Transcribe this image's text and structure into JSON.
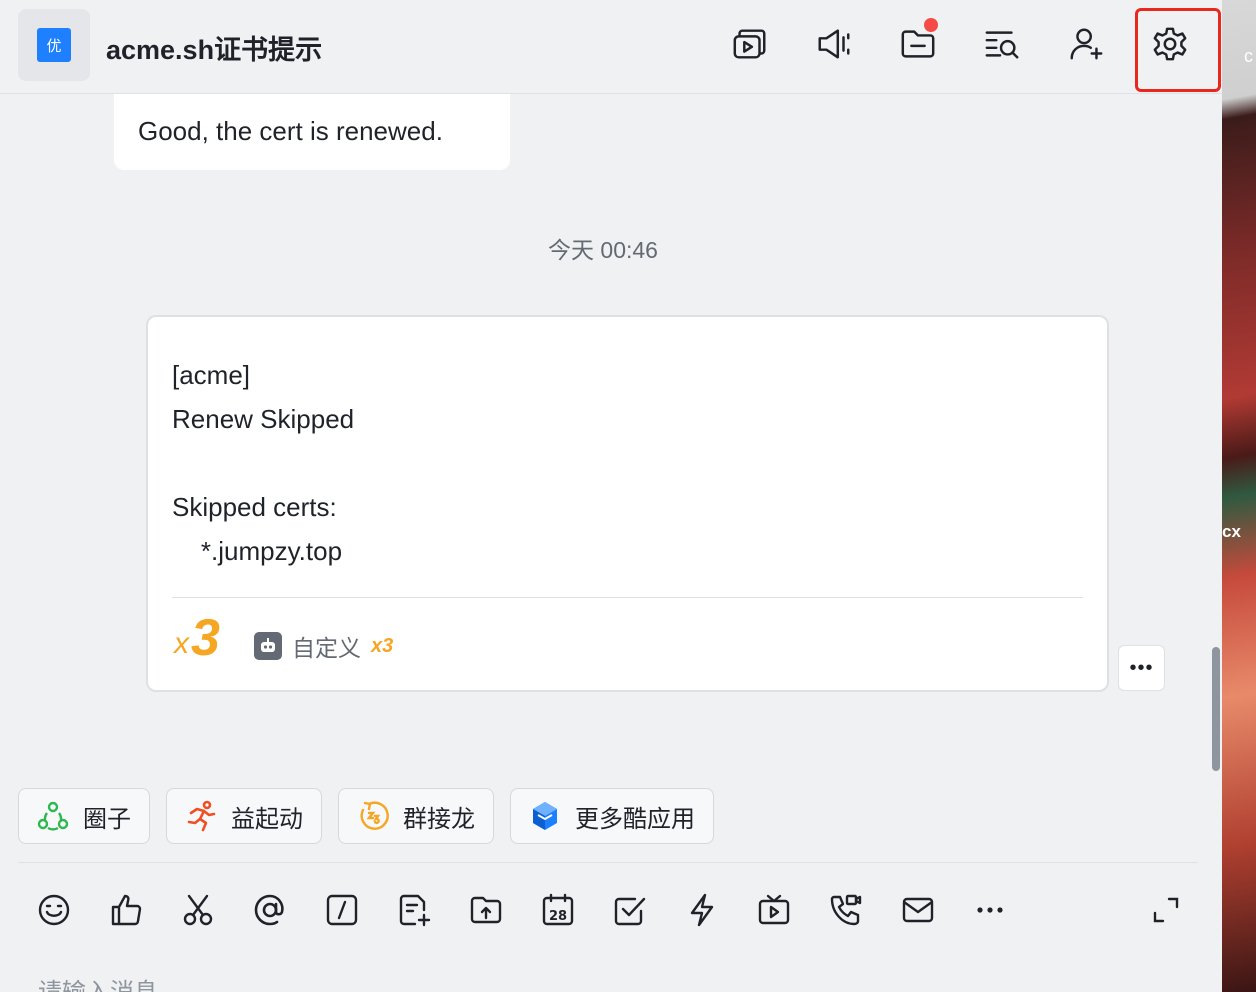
{
  "header": {
    "avatar_text": "优",
    "title": "acme.sh证书提示",
    "icons": [
      "video-icon",
      "announcement-icon",
      "folder-icon",
      "search-history-icon",
      "add-member-icon",
      "settings-icon"
    ]
  },
  "messages": {
    "previous_text": "Good, the cert is renewed.",
    "timestamp": "今天 00:46",
    "card": {
      "line1": "[acme]",
      "line2": "Renew Skipped",
      "line3": "",
      "line4": "Skipped certs:",
      "line5": "    *.jumpzy.top",
      "reaction_x": "x",
      "reaction_count": "3",
      "custom_label": "自定义",
      "custom_count": "x3",
      "more_label": "•••"
    }
  },
  "apps": [
    {
      "label": "圈子",
      "icon": "circle-icon"
    },
    {
      "label": "益起动",
      "icon": "runner-icon"
    },
    {
      "label": "群接龙",
      "icon": "relay-icon"
    },
    {
      "label": "更多酷应用",
      "icon": "cube-icon"
    }
  ],
  "toolbar": {
    "icons": [
      "emoji-icon",
      "thumbs-up-icon",
      "scissors-icon",
      "at-icon",
      "slash-command-icon",
      "doc-add-icon",
      "folder-upload-icon",
      "calendar-icon",
      "checkbox-icon",
      "lightning-icon",
      "tv-icon",
      "phone-video-icon",
      "mail-icon",
      "more-icon",
      "expand-icon"
    ],
    "calendar_day": "28",
    "more_label": "•••"
  },
  "input": {
    "placeholder": "请输入消息"
  },
  "wallpaper": {
    "text_top": "c",
    "text_mid": "cx"
  },
  "colors": {
    "accent": "#1e80ff",
    "highlight": "#e8281f",
    "reaction": "#f5a623",
    "notify_dot": "#f54a45"
  }
}
